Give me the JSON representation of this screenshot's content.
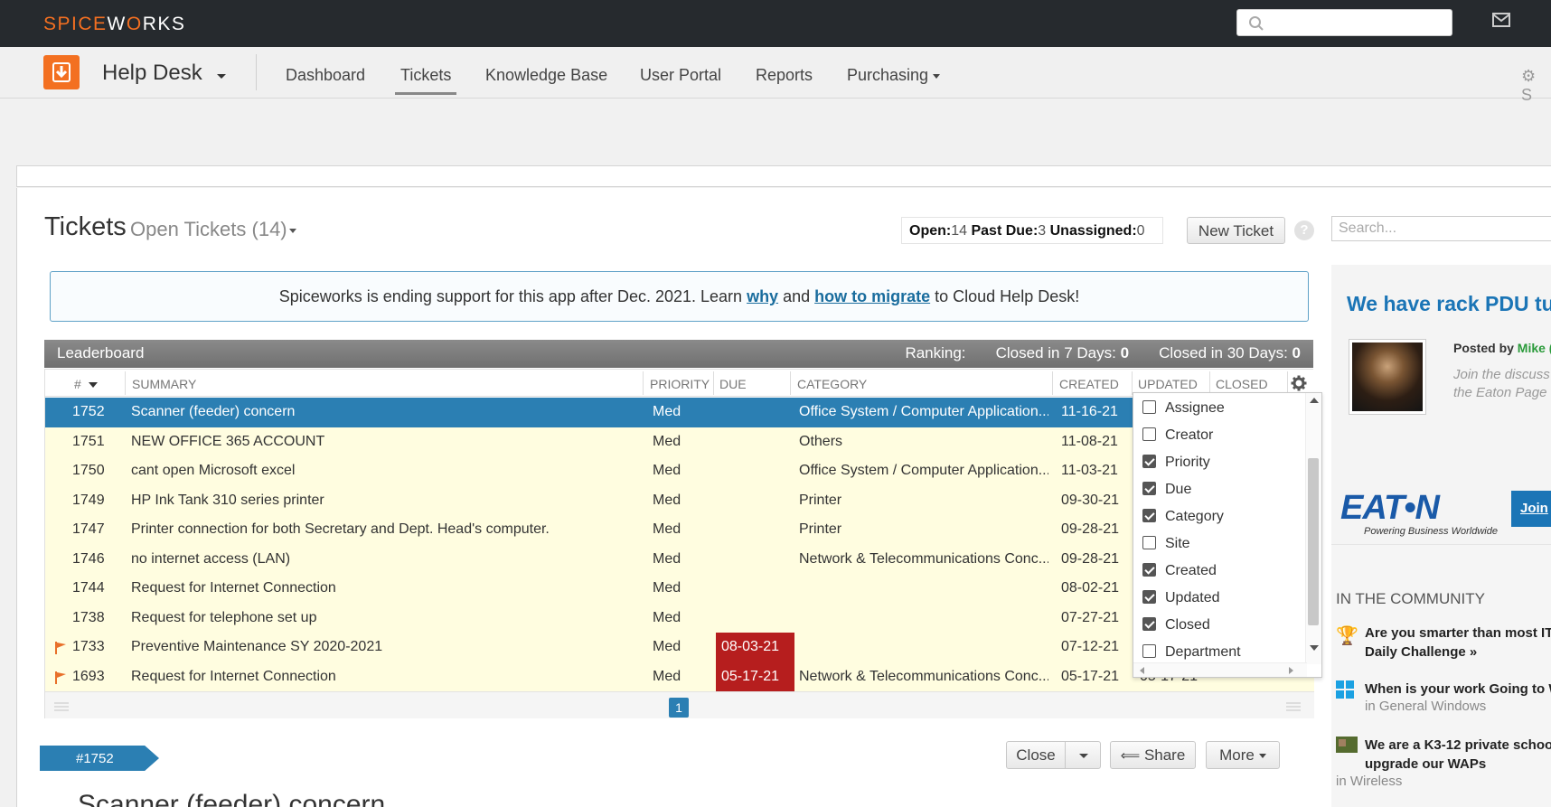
{
  "brand": {
    "logo_a": "SPICE",
    "logo_b": "W",
    "logo_c": "RKS"
  },
  "app": {
    "title": "Help Desk"
  },
  "nav": {
    "items": [
      {
        "label": "Dashboard"
      },
      {
        "label": "Tickets"
      },
      {
        "label": "Knowledge Base"
      },
      {
        "label": "User Portal"
      },
      {
        "label": "Reports"
      },
      {
        "label": "Purchasing"
      }
    ],
    "settings_label": "S"
  },
  "tickets": {
    "title": "Tickets",
    "view": "Open Tickets (14)",
    "stats": {
      "open_label": "Open:",
      "open": "14",
      "pastdue_label": "Past Due:",
      "pastdue": "3",
      "unassigned_label": "Unassigned:",
      "unassigned": "0"
    },
    "new_ticket": "New Ticket",
    "help": "?",
    "search_placeholder": "Search..."
  },
  "banner": {
    "text1": "Spiceworks is ending support for this app after Dec. 2021. Learn ",
    "link1": "why",
    "text2": " and ",
    "link2": "how to migrate",
    "text3": " to Cloud Help Desk!"
  },
  "leaderboard": {
    "title": "Leaderboard",
    "ranking": "Ranking:",
    "closed7_label": "Closed in 7 Days:",
    "closed7": "0",
    "closed30_label": "Closed in 30 Days:",
    "closed30": "0"
  },
  "columns": {
    "num": "#",
    "summary": "SUMMARY",
    "priority": "PRIORITY",
    "due": "DUE",
    "category": "CATEGORY",
    "created": "CREATED",
    "updated": "UPDATED",
    "closed": "CLOSED"
  },
  "rows": [
    {
      "id": "1752",
      "summary": "Scanner (feeder) concern",
      "priority": "Med",
      "due": "",
      "category": "Office System / Computer Application...",
      "created": "11-16-21",
      "flag": false
    },
    {
      "id": "1751",
      "summary": "NEW OFFICE 365 ACCOUNT",
      "priority": "Med",
      "due": "",
      "category": "Others",
      "created": "11-08-21",
      "flag": false
    },
    {
      "id": "1750",
      "summary": "cant open Microsoft excel",
      "priority": "Med",
      "due": "",
      "category": "Office System / Computer Application...",
      "created": "11-03-21",
      "flag": false
    },
    {
      "id": "1749",
      "summary": "HP Ink Tank 310 series printer",
      "priority": "Med",
      "due": "",
      "category": "Printer",
      "created": "09-30-21",
      "flag": false
    },
    {
      "id": "1747",
      "summary": "Printer connection for both Secretary and Dept. Head's computer.",
      "priority": "Med",
      "due": "",
      "category": "Printer",
      "created": "09-28-21",
      "flag": false
    },
    {
      "id": "1746",
      "summary": "no internet access (LAN)",
      "priority": "Med",
      "due": "",
      "category": "Network & Telecommunications Conc...",
      "created": "09-28-21",
      "flag": false
    },
    {
      "id": "1744",
      "summary": "Request for Internet Connection",
      "priority": "Med",
      "due": "",
      "category": "",
      "created": "08-02-21",
      "flag": false
    },
    {
      "id": "1738",
      "summary": "Request for telephone set up",
      "priority": "Med",
      "due": "",
      "category": "",
      "created": "07-27-21",
      "flag": false
    },
    {
      "id": "1733",
      "summary": "Preventive Maintenance SY 2020-2021",
      "priority": "Med",
      "due": "08-03-21",
      "category": "",
      "created": "07-12-21",
      "flag": true
    },
    {
      "id": "1693",
      "summary": "Request for Internet Connection",
      "priority": "Med",
      "due": "05-17-21",
      "category": "Network & Telecommunications Conc...",
      "created": "05-17-21",
      "updated": "05-17-21",
      "flag": true
    }
  ],
  "pager": {
    "page": "1"
  },
  "column_menu": {
    "items": [
      {
        "label": "Assignee",
        "checked": false
      },
      {
        "label": "Creator",
        "checked": false
      },
      {
        "label": "Priority",
        "checked": true
      },
      {
        "label": "Due",
        "checked": true
      },
      {
        "label": "Category",
        "checked": true
      },
      {
        "label": "Site",
        "checked": false
      },
      {
        "label": "Created",
        "checked": true
      },
      {
        "label": "Updated",
        "checked": true
      },
      {
        "label": "Closed",
        "checked": true
      },
      {
        "label": "Department",
        "checked": false
      }
    ]
  },
  "detail": {
    "tag": "#1752",
    "title": "Scanner (feeder) concern",
    "close": "Close",
    "share": "Share",
    "more": "More"
  },
  "side": {
    "ad_title": "We have rack PDU tu",
    "posted_label": "Posted by ",
    "posted_name": "Mike (",
    "join_line1": "Join the discuss",
    "join_line2": "the Eaton Page",
    "eaton": "EAT•N",
    "eaton_tag": "Powering Business Worldwide",
    "join_btn": "Join",
    "community_title": "IN THE COMMUNITY",
    "community": [
      {
        "title1": "Are you smarter than most IT",
        "title2": "Daily Challenge »",
        "sub": ""
      },
      {
        "title1": "When is your work Going to W",
        "title2": "",
        "sub": "in General Windows"
      },
      {
        "title1": "We are a K3-12 private schoo",
        "title2": "upgrade our WAPs",
        "sub": "in Wireless"
      }
    ]
  },
  "colors": {
    "accent": "#2b7fb3",
    "brand": "#f36f21",
    "overdue": "#b61e1e",
    "row_bg": "#fffde0"
  }
}
